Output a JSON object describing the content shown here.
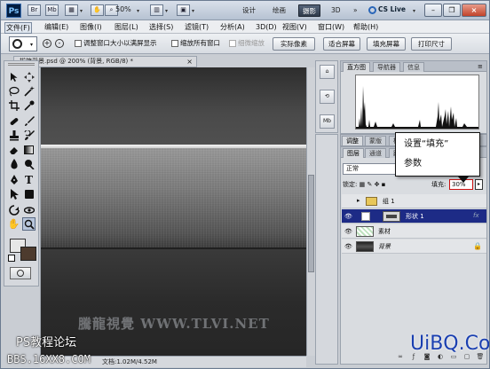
{
  "titlebar": {
    "app_logo": "Ps",
    "zoom": "50%",
    "workspaces": [
      "设计",
      "绘画",
      "摄影",
      "3D"
    ],
    "active_workspace": "摄影",
    "more": "»",
    "cslive": "CS Live",
    "accent": "#2e3a4a"
  },
  "menu": {
    "items": [
      "文件(F)",
      "编辑(E)",
      "图像(I)",
      "图层(L)",
      "选择(S)",
      "滤镜(T)",
      "分析(A)",
      "3D(D)",
      "视图(V)",
      "窗口(W)",
      "帮助(H)"
    ]
  },
  "options": {
    "check_resize": "调整窗口大小以满屏显示",
    "check_all": "缩放所有窗口",
    "scrubby": "细微缩放",
    "btn_actual": "实际像素",
    "btn_fit": "适合屏幕",
    "btn_fill": "填充屏幕",
    "btn_print": "打印尺寸"
  },
  "document": {
    "tab": "拔箱背景.psd @ 200% (背景, RGB/8) *",
    "close": "×",
    "status": "文档:1.02M/4.52M"
  },
  "histogram_panel": {
    "tabs": [
      "直方图",
      "导航器",
      "信息"
    ]
  },
  "adjust_tabs": [
    "调整",
    "蒙版",
    "样式"
  ],
  "layers_panel": {
    "tabs": [
      "图层",
      "通道",
      "路径"
    ],
    "blend_mode": "正常",
    "lock_label": "锁定:",
    "fill_label": "填充:",
    "fill_value": "30%",
    "layers": [
      {
        "name": "组 1",
        "type": "group",
        "visible": false,
        "selected": false
      },
      {
        "name": "形状 1",
        "type": "shape",
        "visible": true,
        "selected": true
      },
      {
        "name": "素材",
        "type": "pixel",
        "visible": true,
        "selected": false
      },
      {
        "name": "背景",
        "type": "background",
        "visible": true,
        "selected": false
      }
    ],
    "fx_glyph": "fx"
  },
  "callout": {
    "line1": "设置“填充”",
    "line2": "参数"
  },
  "overlay": {
    "watermark": "騰龍視覺 WWW.TLVI.NET",
    "forum_title": "PS教程论坛",
    "forum_url": "BBS.16XX8.COM",
    "site_logo": "UiBQ.CoM"
  }
}
